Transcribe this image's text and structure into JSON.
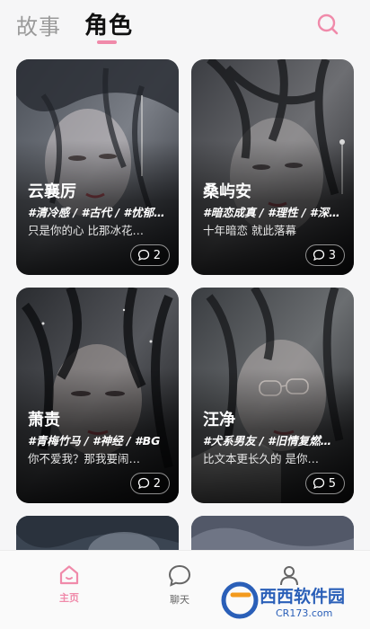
{
  "header": {
    "tabs": [
      {
        "label": "故事",
        "active": false
      },
      {
        "label": "角色",
        "active": true
      }
    ],
    "search_icon": "search-icon",
    "accent": "#f08aaa"
  },
  "cards": [
    {
      "name": "云襄厉",
      "tags": "#清冷感 / #古代 / #忧郁…",
      "desc": "只是你的心 比那冰花…",
      "count": "2"
    },
    {
      "name": "桑屿安",
      "tags": "#暗恋成真 / #理性 / #深…",
      "desc": "十年暗恋 就此落幕",
      "count": "3"
    },
    {
      "name": "萧责",
      "tags": "#青梅竹马 / #神经 / #BG",
      "desc": "你不爱我？那我要闹…",
      "count": "2"
    },
    {
      "name": "汪净",
      "tags": "#犬系男友 / #旧情复燃…",
      "desc": "比文本更长久的 是你…",
      "count": "5"
    }
  ],
  "bottom_nav": [
    {
      "label": "主页",
      "icon": "home-icon",
      "active": true
    },
    {
      "label": "聊天",
      "icon": "chat-bubble-icon",
      "active": false
    },
    {
      "label": "",
      "icon": "profile-icon",
      "active": false
    }
  ],
  "watermark": {
    "brand": "西西软件园",
    "url": "CR173.com"
  }
}
